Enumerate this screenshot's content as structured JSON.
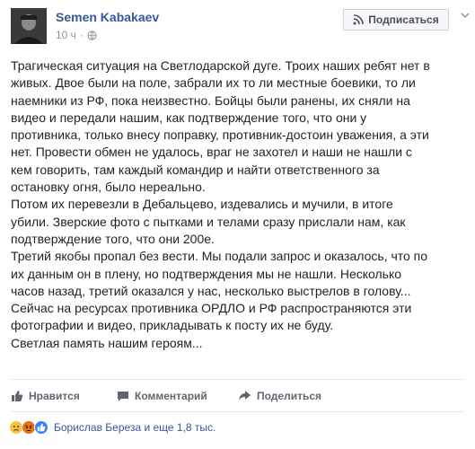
{
  "post": {
    "author": "Semen Kabakaev",
    "time": "10 ч",
    "meta_separator": "·",
    "follow_label": "Подписаться",
    "lines": [
      "Трагическая ситуация на Светлодарской дуге. Троих наших ребят нет в",
      "живых. Двое были на поле, забрали их то ли местные боевики, то ли",
      "наемники из РФ, пока неизвестно. Бойцы были ранены, их сняли на",
      "видео и передали нашим, как подтверждение того, что они у",
      "противника, только внесу поправку, противник-достоин уважения, а эти",
      "нет. Провести обмен не удалось, враг не захотел и наши не нашли с",
      "кем говорить, там каждый командир и найти ответственного за",
      "остановку огня, было нереально.",
      "Потом их перевезли в Дебальцево, издевались и мучили, в итоге",
      "убили. Зверские фото с пытками и телами сразу прислали нам, как",
      "подтверждение того, что они 200е.",
      "Третий якобы пропал без вести. Мы подали запрос и оказалось, что по",
      "их данным он в плену, но подтверждения мы не нашли. Несколько",
      "часов назад, третий оказался у нас, несколько выстрелов в голову...",
      "Сейчас на ресурсах противника ОРДЛО и РФ распространяются эти",
      "фотографии и видео, прикладывать к посту их не буду.",
      "Светлая память нашим героям..."
    ]
  },
  "actions": {
    "like": "Нравится",
    "comment": "Комментарий",
    "share": "Поделиться"
  },
  "reactions": {
    "icons": [
      "sad-reaction",
      "angry-reaction",
      "like-reaction"
    ],
    "summary": "Борислав Береза и еще 1,8 тыс."
  },
  "colors": {
    "link": "#365899",
    "text": "#1d2129",
    "muted": "#90949c",
    "like_blue": "#4080ff",
    "sad_yellow": "#f7c33f",
    "angry_red": "#e9710f"
  }
}
